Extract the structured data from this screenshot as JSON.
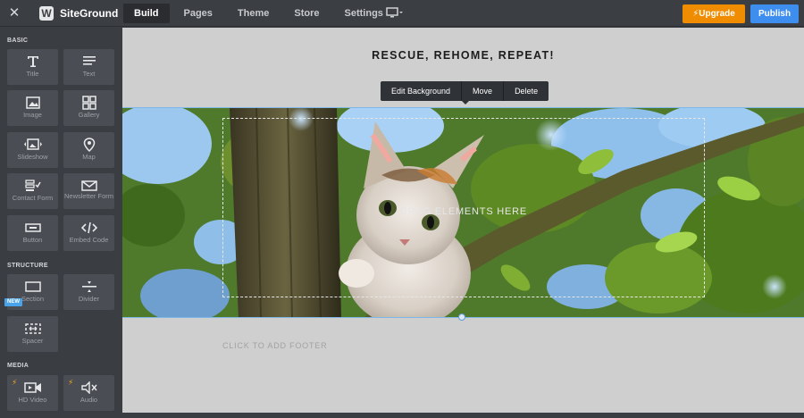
{
  "topbar": {
    "brand": "SiteGround",
    "tabs": [
      {
        "label": "Build",
        "active": true
      },
      {
        "label": "Pages"
      },
      {
        "label": "Theme"
      },
      {
        "label": "Store"
      },
      {
        "label": "Settings"
      }
    ],
    "upgrade_label": "Upgrade",
    "publish_label": "Publish",
    "colors": {
      "upgrade": "#f08c00",
      "publish": "#3e8ef0"
    }
  },
  "sidebar": {
    "basic": {
      "title": "BASIC",
      "items": [
        {
          "label": "Title",
          "icon": "title-icon"
        },
        {
          "label": "Text",
          "icon": "text-lines-icon"
        },
        {
          "label": "Image",
          "icon": "image-icon"
        },
        {
          "label": "Gallery",
          "icon": "gallery-grid-icon"
        },
        {
          "label": "Slideshow",
          "icon": "slideshow-icon"
        },
        {
          "label": "Map",
          "icon": "map-pin-icon"
        },
        {
          "label": "Contact Form",
          "icon": "contact-form-icon"
        },
        {
          "label": "Newsletter Form",
          "icon": "envelope-icon"
        },
        {
          "label": "Button",
          "icon": "button-icon"
        },
        {
          "label": "Embed Code",
          "icon": "code-icon"
        }
      ]
    },
    "structure": {
      "title": "STRUCTURE",
      "new_badge": "NEW",
      "items": [
        {
          "label": "Section",
          "icon": "section-icon"
        },
        {
          "label": "Divider",
          "icon": "divider-icon"
        },
        {
          "label": "Spacer",
          "icon": "spacer-icon"
        }
      ]
    },
    "media": {
      "title": "MEDIA",
      "items": [
        {
          "label": "HD Video",
          "icon": "video-camera-icon",
          "premium": true
        },
        {
          "label": "Audio",
          "icon": "speaker-icon",
          "premium": true
        }
      ]
    }
  },
  "canvas": {
    "heading": "RESCUE, REHOME, REPEAT!",
    "toolbar": {
      "edit_background": "Edit Background",
      "move": "Move",
      "delete": "Delete"
    },
    "drop_text": "DRAG ELEMENTS HERE",
    "footer_hint": "CLICK TO ADD FOOTER"
  }
}
